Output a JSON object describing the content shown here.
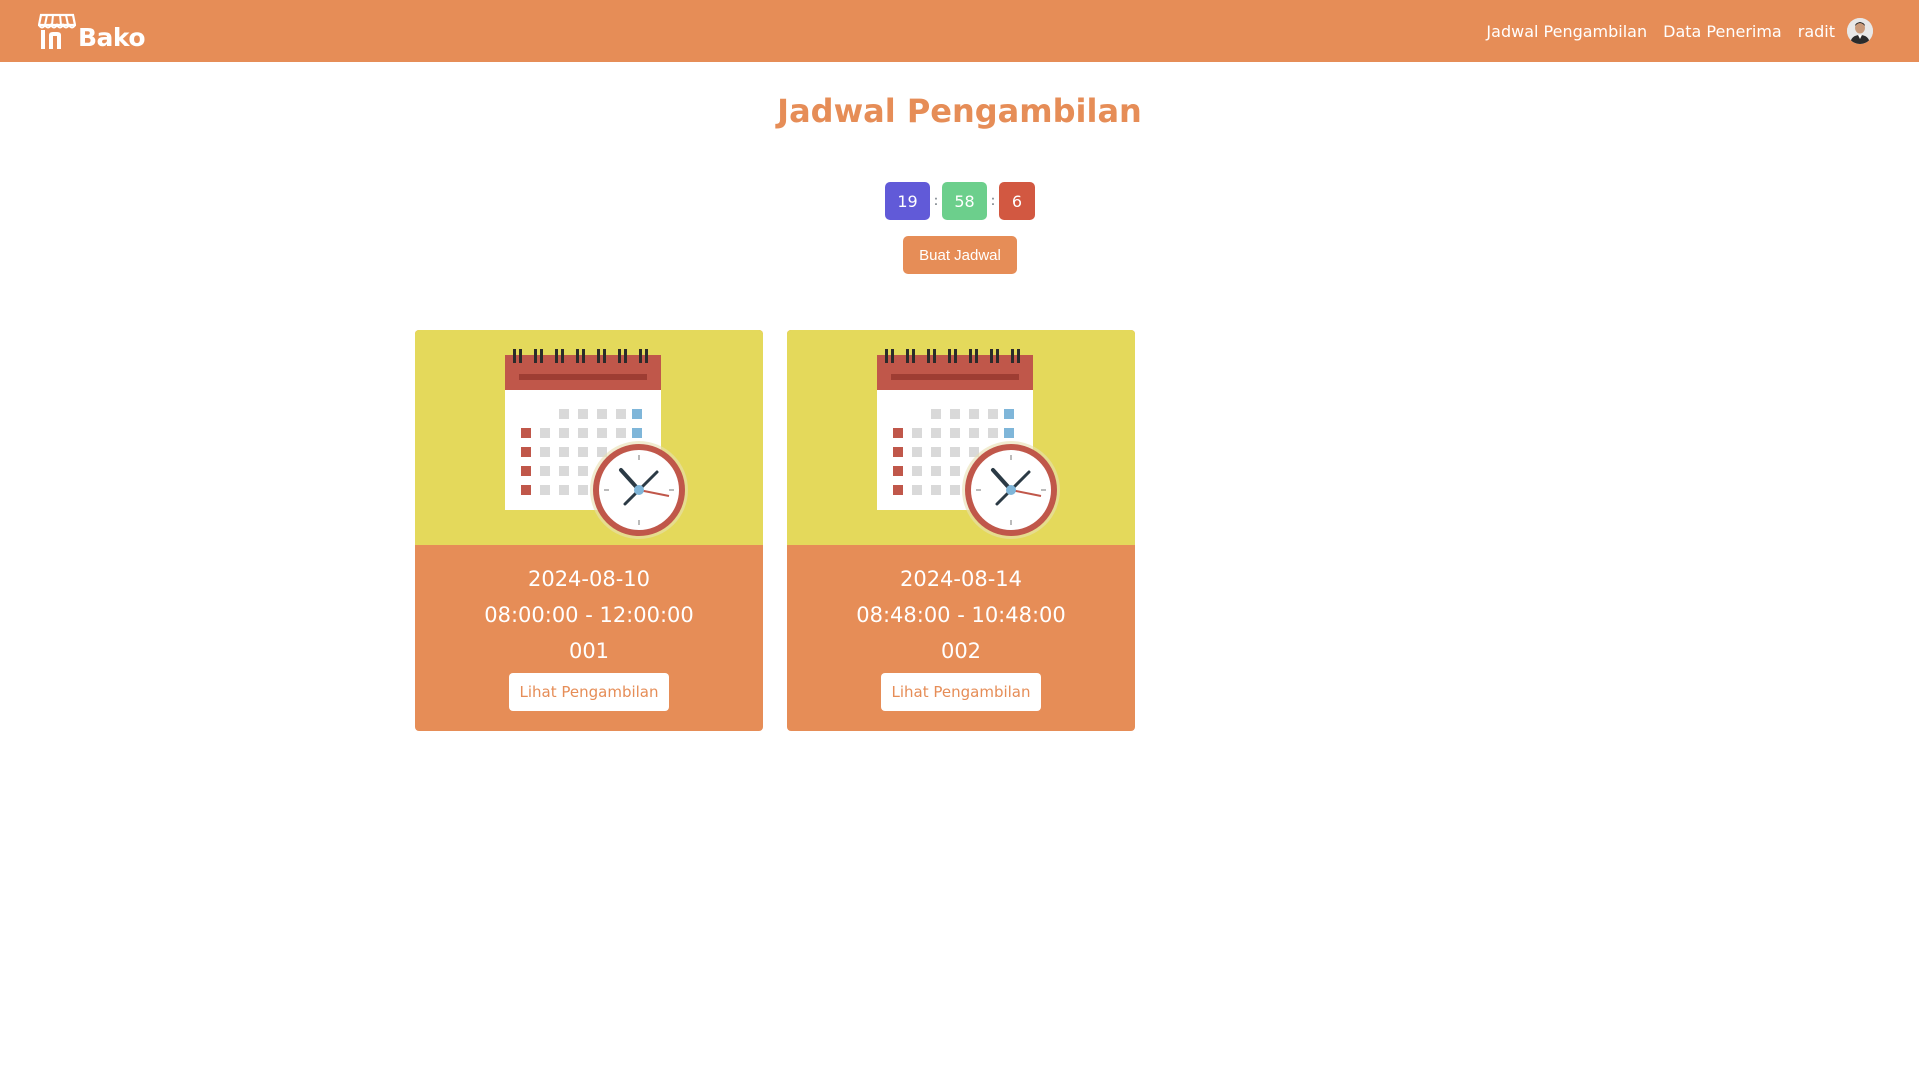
{
  "navbar": {
    "logo_text": "Bako",
    "links": [
      "Jadwal Pengambilan",
      "Data Penerima"
    ],
    "user_name": "radit",
    "color": "#e68d57"
  },
  "page": {
    "title": "Jadwal Pengambilan"
  },
  "countdown": {
    "hours": "19",
    "minutes": "58",
    "seconds": "6",
    "separator": ":",
    "colors": {
      "hours": "#615ad8",
      "minutes": "#6ccf8c",
      "seconds": "#d25841"
    }
  },
  "actions": {
    "create_label": "Buat Jadwal"
  },
  "schedules": [
    {
      "date": "2024-08-10",
      "time": "08:00:00 - 12:00:00",
      "code": "001",
      "button": "Lihat Pengambilan"
    },
    {
      "date": "2024-08-14",
      "time": "08:48:00 - 10:48:00",
      "code": "002",
      "button": "Lihat Pengambilan"
    }
  ],
  "icons": {
    "logo": "store-awning-icon",
    "card_image": "calendar-clock-icon",
    "avatar": "user-avatar"
  }
}
